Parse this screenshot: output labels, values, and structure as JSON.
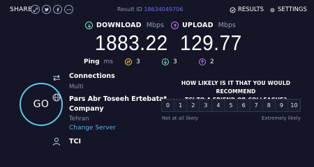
{
  "header": {
    "share_label": "SHARE",
    "share_icons": [
      "link-icon",
      "twitter-icon",
      "facebook-icon",
      "more-icon"
    ],
    "result_label": "Result ID",
    "result_id": "18634049706",
    "results_label": "RESULTS",
    "settings_label": "SETTINGS"
  },
  "download": {
    "label": "DOWNLOAD",
    "unit": "Mbps",
    "value": "1883.22",
    "color": "#7de8d0"
  },
  "upload": {
    "label": "UPLOAD",
    "unit": "Mbps",
    "value": "129.77",
    "color": "#c47df2"
  },
  "ping": {
    "label": "Ping",
    "unit": "ms",
    "idle": "3",
    "download": "3",
    "upload": "2",
    "idle_color": "#f2d94c"
  },
  "go_label": "GO",
  "connections": {
    "title": "Connections",
    "value": "Multi"
  },
  "server": {
    "name_line1": "Pars Abr Toseeh Ertebatat",
    "name_line2": "Company",
    "location": "Tehran",
    "change_label": "Change Server"
  },
  "isp": {
    "name": "TCI"
  },
  "survey": {
    "question_line1": "HOW LIKELY IS IT THAT YOU WOULD RECOMMEND",
    "question_line2": "TCI TO A FRIEND OR COLLEAGUE?",
    "options": [
      "0",
      "1",
      "2",
      "3",
      "4",
      "5",
      "6",
      "7",
      "8",
      "9",
      "10"
    ],
    "low_label": "Not at all likely",
    "high_label": "Extremely likely"
  }
}
